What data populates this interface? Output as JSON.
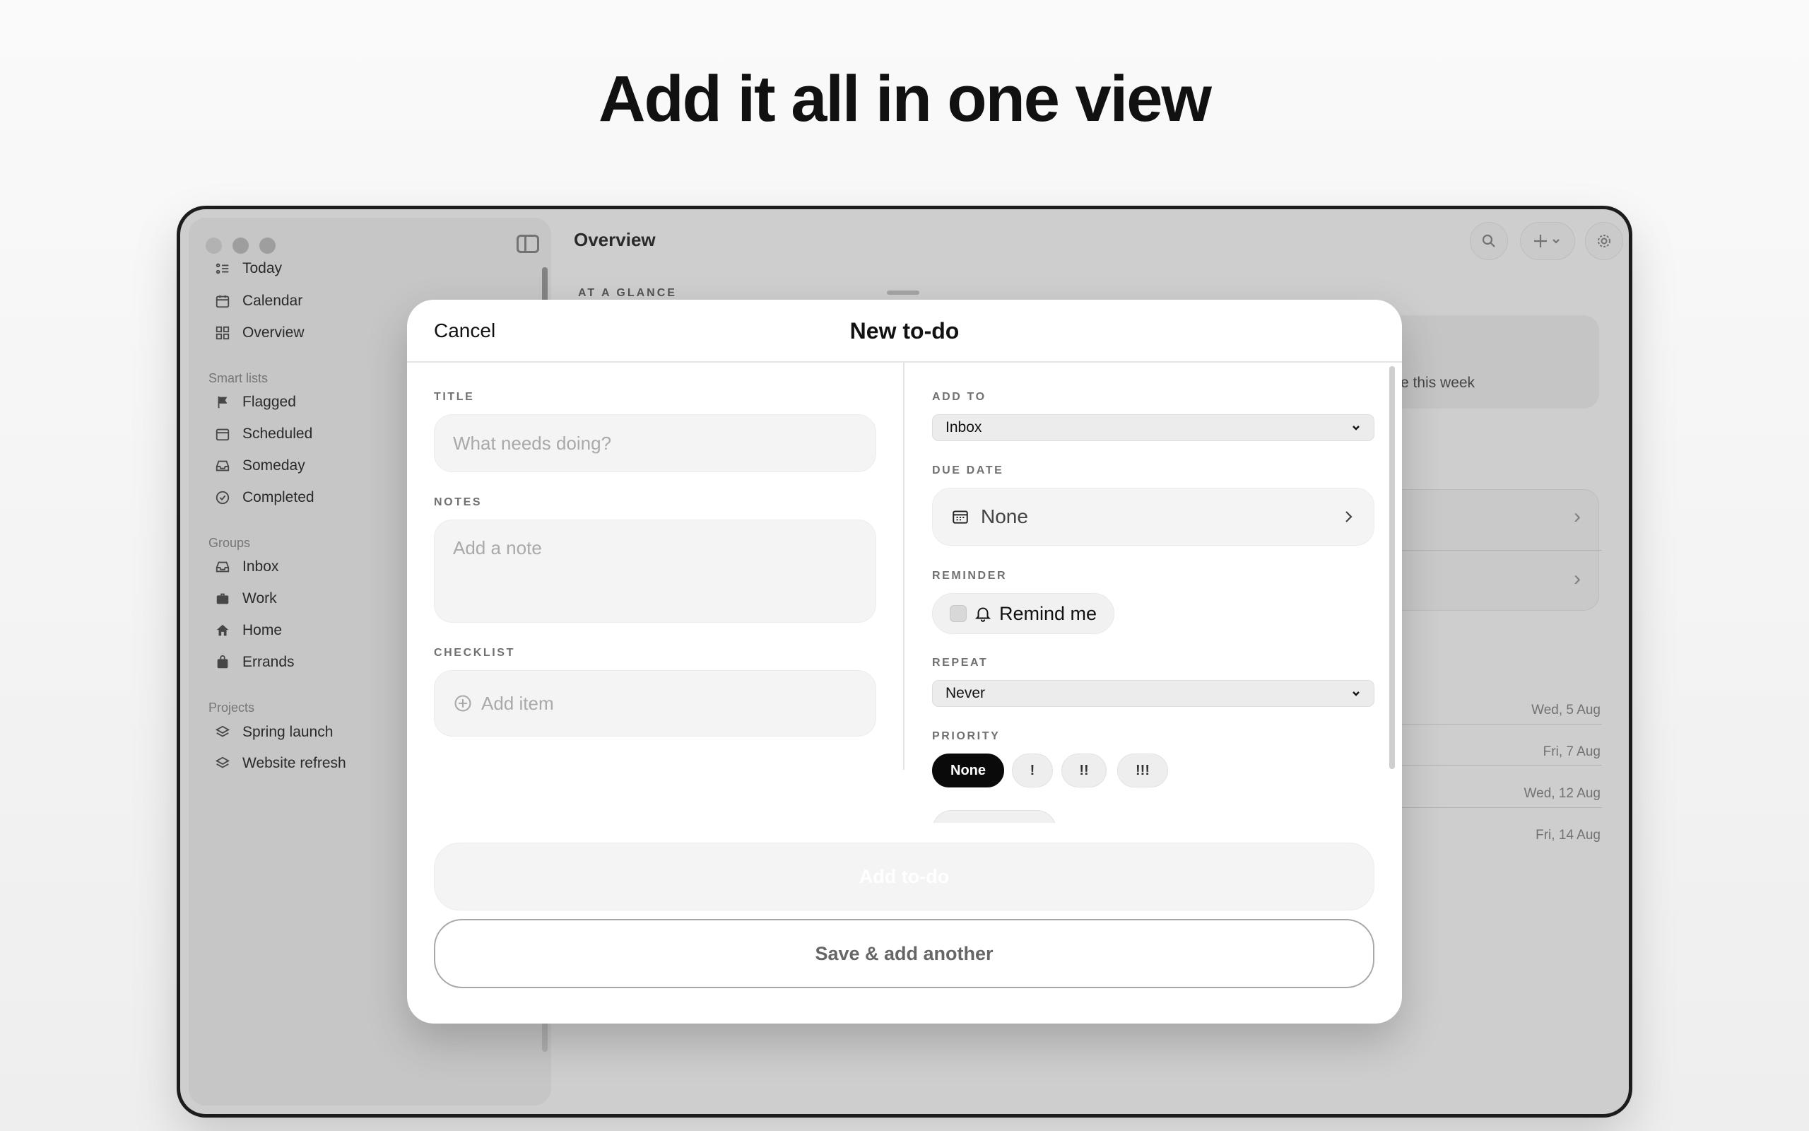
{
  "headline": "Add it all in one view",
  "window": {
    "main_title": "Overview",
    "section_glance": "AT A GLANCE",
    "card_text": "e this week",
    "sidebar": {
      "items_top": [
        {
          "label": "Today",
          "icon": "list-icon"
        },
        {
          "label": "Calendar",
          "icon": "calendar-icon"
        },
        {
          "label": "Overview",
          "icon": "grid-icon"
        }
      ],
      "smart_lists_label": "Smart lists",
      "smart_lists": [
        {
          "label": "Flagged",
          "icon": "flag-icon"
        },
        {
          "label": "Scheduled",
          "icon": "calendar-icon"
        },
        {
          "label": "Someday",
          "icon": "tray-icon"
        },
        {
          "label": "Completed",
          "icon": "check-circle-icon"
        }
      ],
      "groups_label": "Groups",
      "groups": [
        {
          "label": "Inbox",
          "icon": "tray-icon"
        },
        {
          "label": "Work",
          "icon": "briefcase-icon"
        },
        {
          "label": "Home",
          "icon": "house-icon"
        },
        {
          "label": "Errands",
          "icon": "bag-icon"
        }
      ],
      "projects_label": "Projects",
      "projects": [
        {
          "label": "Spring launch",
          "icon": "layers-icon"
        },
        {
          "label": "Website refresh",
          "icon": "layers-icon"
        }
      ]
    },
    "dates": [
      "Wed, 5 Aug",
      "Fri, 7 Aug",
      "Wed, 12 Aug",
      "Fri, 14 Aug"
    ]
  },
  "modal": {
    "cancel_label": "Cancel",
    "title": "New to-do",
    "title_label": "TITLE",
    "title_placeholder": "What needs doing?",
    "notes_label": "NOTES",
    "notes_placeholder": "Add a note",
    "checklist_label": "CHECKLIST",
    "checklist_add": "Add item",
    "add_to_label": "ADD TO",
    "add_to_value": "Inbox",
    "due_date_label": "DUE DATE",
    "due_date_value": "None",
    "reminder_label": "REMINDER",
    "reminder_value": "Remind me",
    "repeat_label": "REPEAT",
    "repeat_value": "Never",
    "priority_label": "PRIORITY",
    "priority_options": [
      "None",
      "!",
      "!!",
      "!!!"
    ],
    "priority_selected": "None",
    "primary_button": "Add to-do",
    "secondary_button": "Save & add another"
  }
}
